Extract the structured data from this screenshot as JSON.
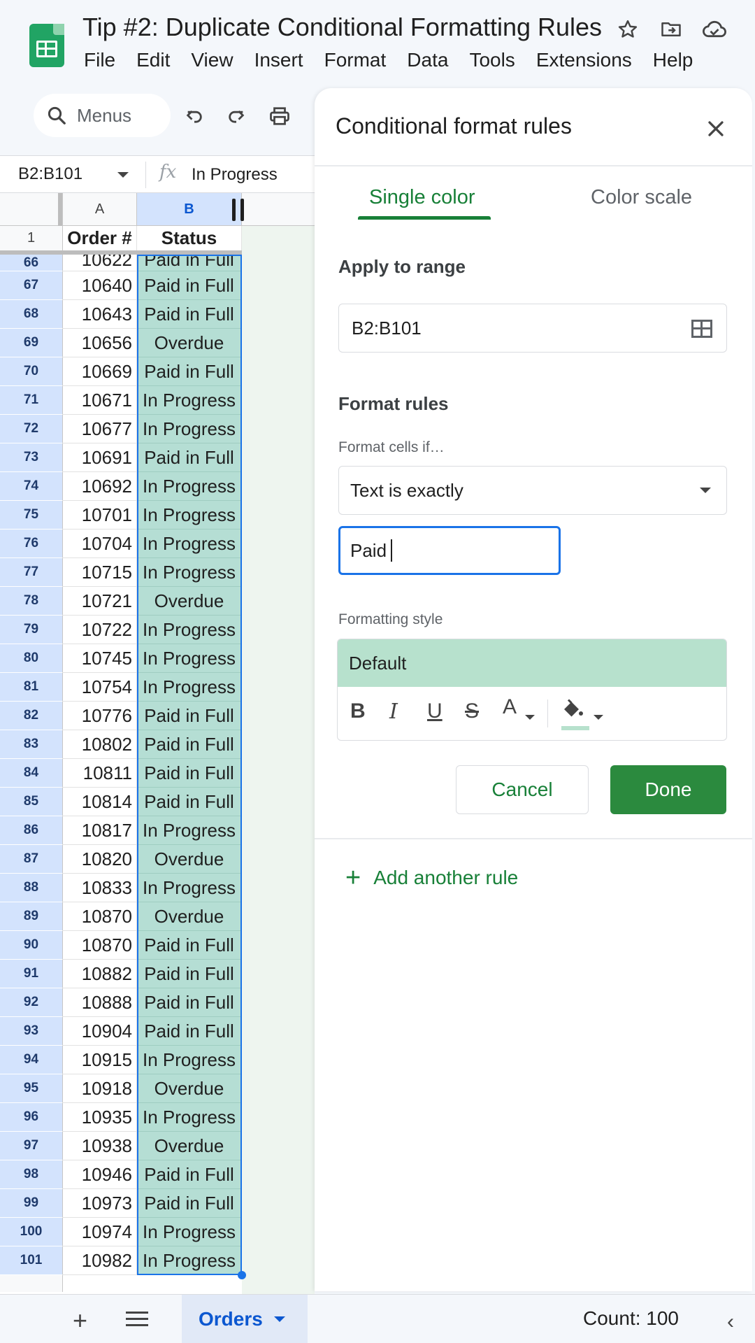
{
  "header": {
    "title": "Tip #2: Duplicate Conditional Formatting Rules",
    "menu": [
      "File",
      "Edit",
      "View",
      "Insert",
      "Format",
      "Data",
      "Tools",
      "Extensions",
      "Help"
    ]
  },
  "toolbar": {
    "search_label": "Menus"
  },
  "formula_bar": {
    "name_box": "B2:B101",
    "fx": "fx",
    "value": "In Progress"
  },
  "sheet": {
    "col_a": "A",
    "col_b": "B",
    "header_row_num": "1",
    "header_a": "Order #",
    "header_b": "Status",
    "partial_row": {
      "num": "66",
      "order": "10622",
      "status": "Paid in Full"
    },
    "rows": [
      {
        "num": "67",
        "order": "10640",
        "status": "Paid in Full"
      },
      {
        "num": "68",
        "order": "10643",
        "status": "Paid in Full"
      },
      {
        "num": "69",
        "order": "10656",
        "status": "Overdue"
      },
      {
        "num": "70",
        "order": "10669",
        "status": "Paid in Full"
      },
      {
        "num": "71",
        "order": "10671",
        "status": "In Progress"
      },
      {
        "num": "72",
        "order": "10677",
        "status": "In Progress"
      },
      {
        "num": "73",
        "order": "10691",
        "status": "Paid in Full"
      },
      {
        "num": "74",
        "order": "10692",
        "status": "In Progress"
      },
      {
        "num": "75",
        "order": "10701",
        "status": "In Progress"
      },
      {
        "num": "76",
        "order": "10704",
        "status": "In Progress"
      },
      {
        "num": "77",
        "order": "10715",
        "status": "In Progress"
      },
      {
        "num": "78",
        "order": "10721",
        "status": "Overdue"
      },
      {
        "num": "79",
        "order": "10722",
        "status": "In Progress"
      },
      {
        "num": "80",
        "order": "10745",
        "status": "In Progress"
      },
      {
        "num": "81",
        "order": "10754",
        "status": "In Progress"
      },
      {
        "num": "82",
        "order": "10776",
        "status": "Paid in Full"
      },
      {
        "num": "83",
        "order": "10802",
        "status": "Paid in Full"
      },
      {
        "num": "84",
        "order": "10811",
        "status": "Paid in Full"
      },
      {
        "num": "85",
        "order": "10814",
        "status": "Paid in Full"
      },
      {
        "num": "86",
        "order": "10817",
        "status": "In Progress"
      },
      {
        "num": "87",
        "order": "10820",
        "status": "Overdue"
      },
      {
        "num": "88",
        "order": "10833",
        "status": "In Progress"
      },
      {
        "num": "89",
        "order": "10870",
        "status": "Overdue"
      },
      {
        "num": "90",
        "order": "10870",
        "status": "Paid in Full"
      },
      {
        "num": "91",
        "order": "10882",
        "status": "Paid in Full"
      },
      {
        "num": "92",
        "order": "10888",
        "status": "Paid in Full"
      },
      {
        "num": "93",
        "order": "10904",
        "status": "Paid in Full"
      },
      {
        "num": "94",
        "order": "10915",
        "status": "In Progress"
      },
      {
        "num": "95",
        "order": "10918",
        "status": "Overdue"
      },
      {
        "num": "96",
        "order": "10935",
        "status": "In Progress"
      },
      {
        "num": "97",
        "order": "10938",
        "status": "Overdue"
      },
      {
        "num": "98",
        "order": "10946",
        "status": "Paid in Full"
      },
      {
        "num": "99",
        "order": "10973",
        "status": "Paid in Full"
      },
      {
        "num": "100",
        "order": "10974",
        "status": "In Progress"
      },
      {
        "num": "101",
        "order": "10982",
        "status": "In Progress"
      }
    ]
  },
  "bottom_bar": {
    "sheet_name": "Orders",
    "count": "Count: 100"
  },
  "panel": {
    "title": "Conditional format rules",
    "tab_single": "Single color",
    "tab_scale": "Color scale",
    "apply_label": "Apply to range",
    "range_value": "B2:B101",
    "format_rules_label": "Format rules",
    "format_if_label": "Format cells if…",
    "condition": "Text is exactly",
    "value": "Paid",
    "style_label": "Formatting style",
    "style_preview": "Default",
    "style_tools": {
      "bold": "B",
      "italic": "I",
      "underline": "U",
      "strike": "S",
      "text_color": "A"
    },
    "cancel": "Cancel",
    "done": "Done",
    "add_rule": "Add another rule"
  },
  "colors": {
    "accent_green": "#188038",
    "done_button": "#2b8a3e",
    "selection_blue": "#1a73e8",
    "format_fill": "#b7e1cd"
  }
}
